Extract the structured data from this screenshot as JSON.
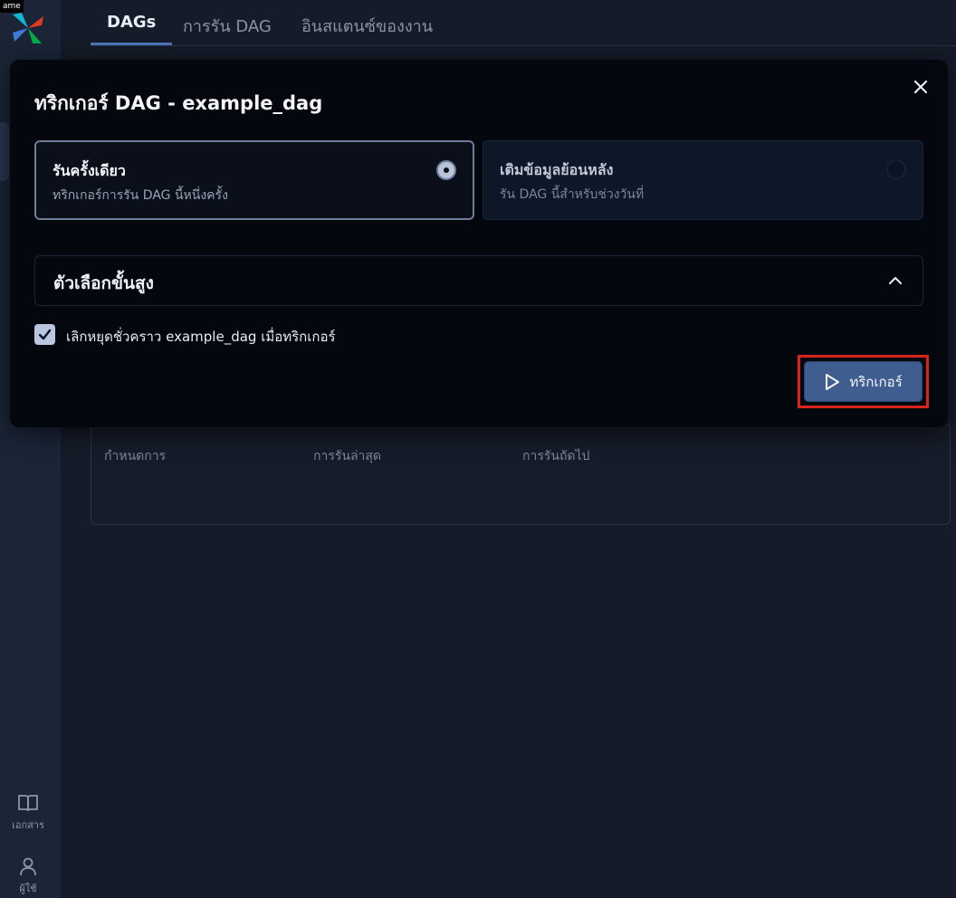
{
  "tooltip": "ame",
  "tabs": [
    {
      "label": "DAGs",
      "active": true
    },
    {
      "label": "การรัน DAG",
      "active": false
    },
    {
      "label": "อินสแตนซ์ของงาน",
      "active": false
    }
  ],
  "sidebar": {
    "docs_label": "เอกสาร",
    "user_label": "ผู้ใช้"
  },
  "background_card": {
    "columns": [
      "กำหนดการ",
      "การรันล่าสุด",
      "การรันถัดไป"
    ]
  },
  "modal": {
    "title": "ทริกเกอร์ DAG - example_dag",
    "options": [
      {
        "title": "รันครั้งเดียว",
        "description": "ทริกเกอร์การรัน DAG นี้หนึ่งครั้ง",
        "selected": true
      },
      {
        "title": "เติมข้อมูลย้อนหลัง",
        "description": "รัน DAG นี้สำหรับช่วงวันที่",
        "selected": false
      }
    ],
    "advanced_label": "ตัวเลือกขั้นสูง",
    "unpause_checkbox": {
      "label": "เลิกหยุดชั่วคราว example_dag เมื่อทริกเกอร์",
      "checked": true
    },
    "trigger_button_label": "ทริกเกอร์"
  },
  "colors": {
    "accent": "#3f5d8f",
    "highlight": "#d8241b",
    "background": "#151b28"
  }
}
